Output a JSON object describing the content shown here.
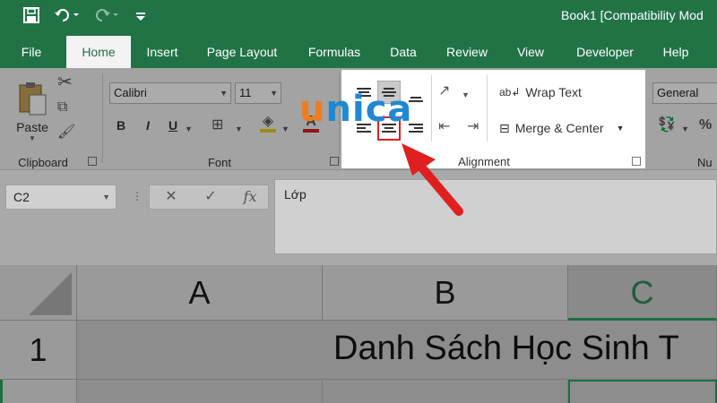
{
  "title_bar": {
    "save_icon": "save-icon",
    "undo_icon": "undo-icon",
    "redo_icon": "redo-icon",
    "customize_icon": "customize-icon",
    "document_title": "Book1  [Compatibility Mod"
  },
  "tabs": [
    {
      "label": "File"
    },
    {
      "label": "Home",
      "active": true
    },
    {
      "label": "Insert"
    },
    {
      "label": "Page Layout"
    },
    {
      "label": "Formulas"
    },
    {
      "label": "Data"
    },
    {
      "label": "Review"
    },
    {
      "label": "View"
    },
    {
      "label": "Developer"
    },
    {
      "label": "Help"
    }
  ],
  "ribbon": {
    "clipboard": {
      "paste_label": "Paste",
      "group_label": "Clipboard"
    },
    "font": {
      "font_name": "Calibri",
      "font_size": "11",
      "bold": "B",
      "italic": "I",
      "underline": "U",
      "group_label": "Font"
    },
    "alignment": {
      "wrap_text": "Wrap Text",
      "merge_center": "Merge & Center",
      "group_label": "Alignment"
    },
    "number": {
      "format": "General",
      "percent": "%",
      "group_label": "Nu"
    }
  },
  "formula_bar": {
    "name_box": "C2",
    "cancel": "✕",
    "enter": "✓",
    "fx": "fx",
    "content": "Lớp"
  },
  "grid": {
    "columns": [
      "A",
      "B",
      "C"
    ],
    "rows": [
      "1"
    ],
    "cell_text": "Danh Sách Học Sinh T"
  },
  "logo": {
    "letters": [
      "u",
      "n",
      "i",
      "c",
      "a"
    ],
    "colors": [
      "#f07c1e",
      "#1e88d4",
      "#1e88d4",
      "#1e88d4",
      "#1e88d4"
    ]
  },
  "colors": {
    "excel_green": "#217346",
    "highlight_red": "#e02020"
  }
}
